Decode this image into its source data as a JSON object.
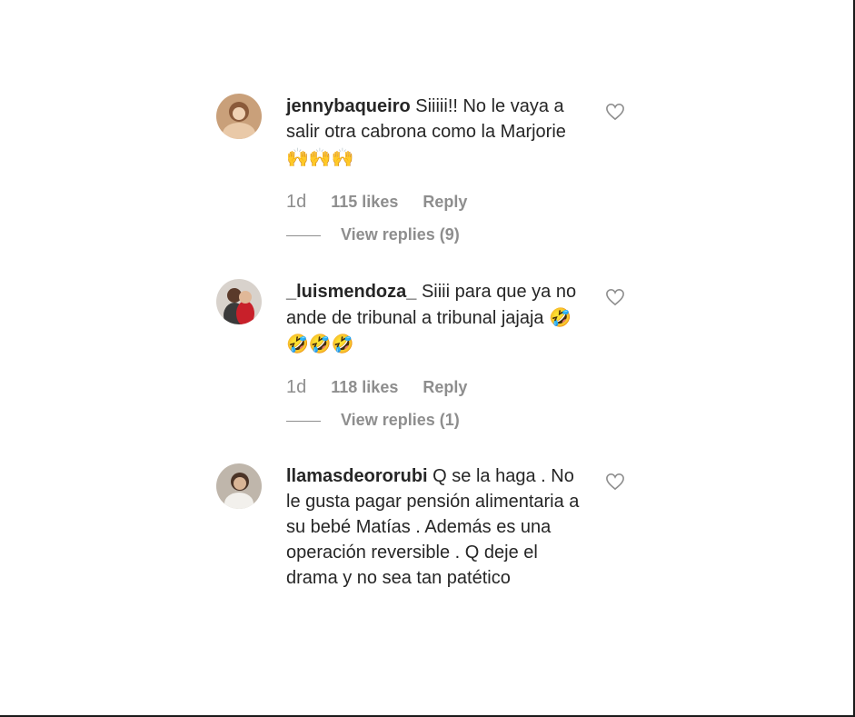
{
  "comments": [
    {
      "username": "jennybaqueiro",
      "text": "Siiiii!! No le vaya a salir otra cabrona como la Marjorie",
      "emoji": "🙌🙌🙌",
      "time": "1d",
      "likes": "115 likes",
      "reply_label": "Reply",
      "view_replies": "View replies (9)",
      "avatar_icon": "user-avatar-icon",
      "like_icon": "heart-outline-icon"
    },
    {
      "username": "_luismendoza_",
      "text": "Siiii para que ya no ande de tribunal a tribunal jajaja",
      "emoji": "🤣🤣🤣🤣",
      "time": "1d",
      "likes": "118 likes",
      "reply_label": "Reply",
      "view_replies": "View replies (1)",
      "avatar_icon": "user-avatar-icon",
      "like_icon": "heart-outline-icon"
    },
    {
      "username": "llamasdeororubi",
      "text": "Q se la haga . No le gusta pagar pensión alimentaria a su bebé Matías . Además es una operación reversible . Q deje el drama y no sea tan patético",
      "emoji": "",
      "avatar_icon": "user-avatar-icon",
      "like_icon": "heart-outline-icon"
    }
  ],
  "colors": {
    "text": "#262626",
    "secondary": "#8e8e8e"
  }
}
